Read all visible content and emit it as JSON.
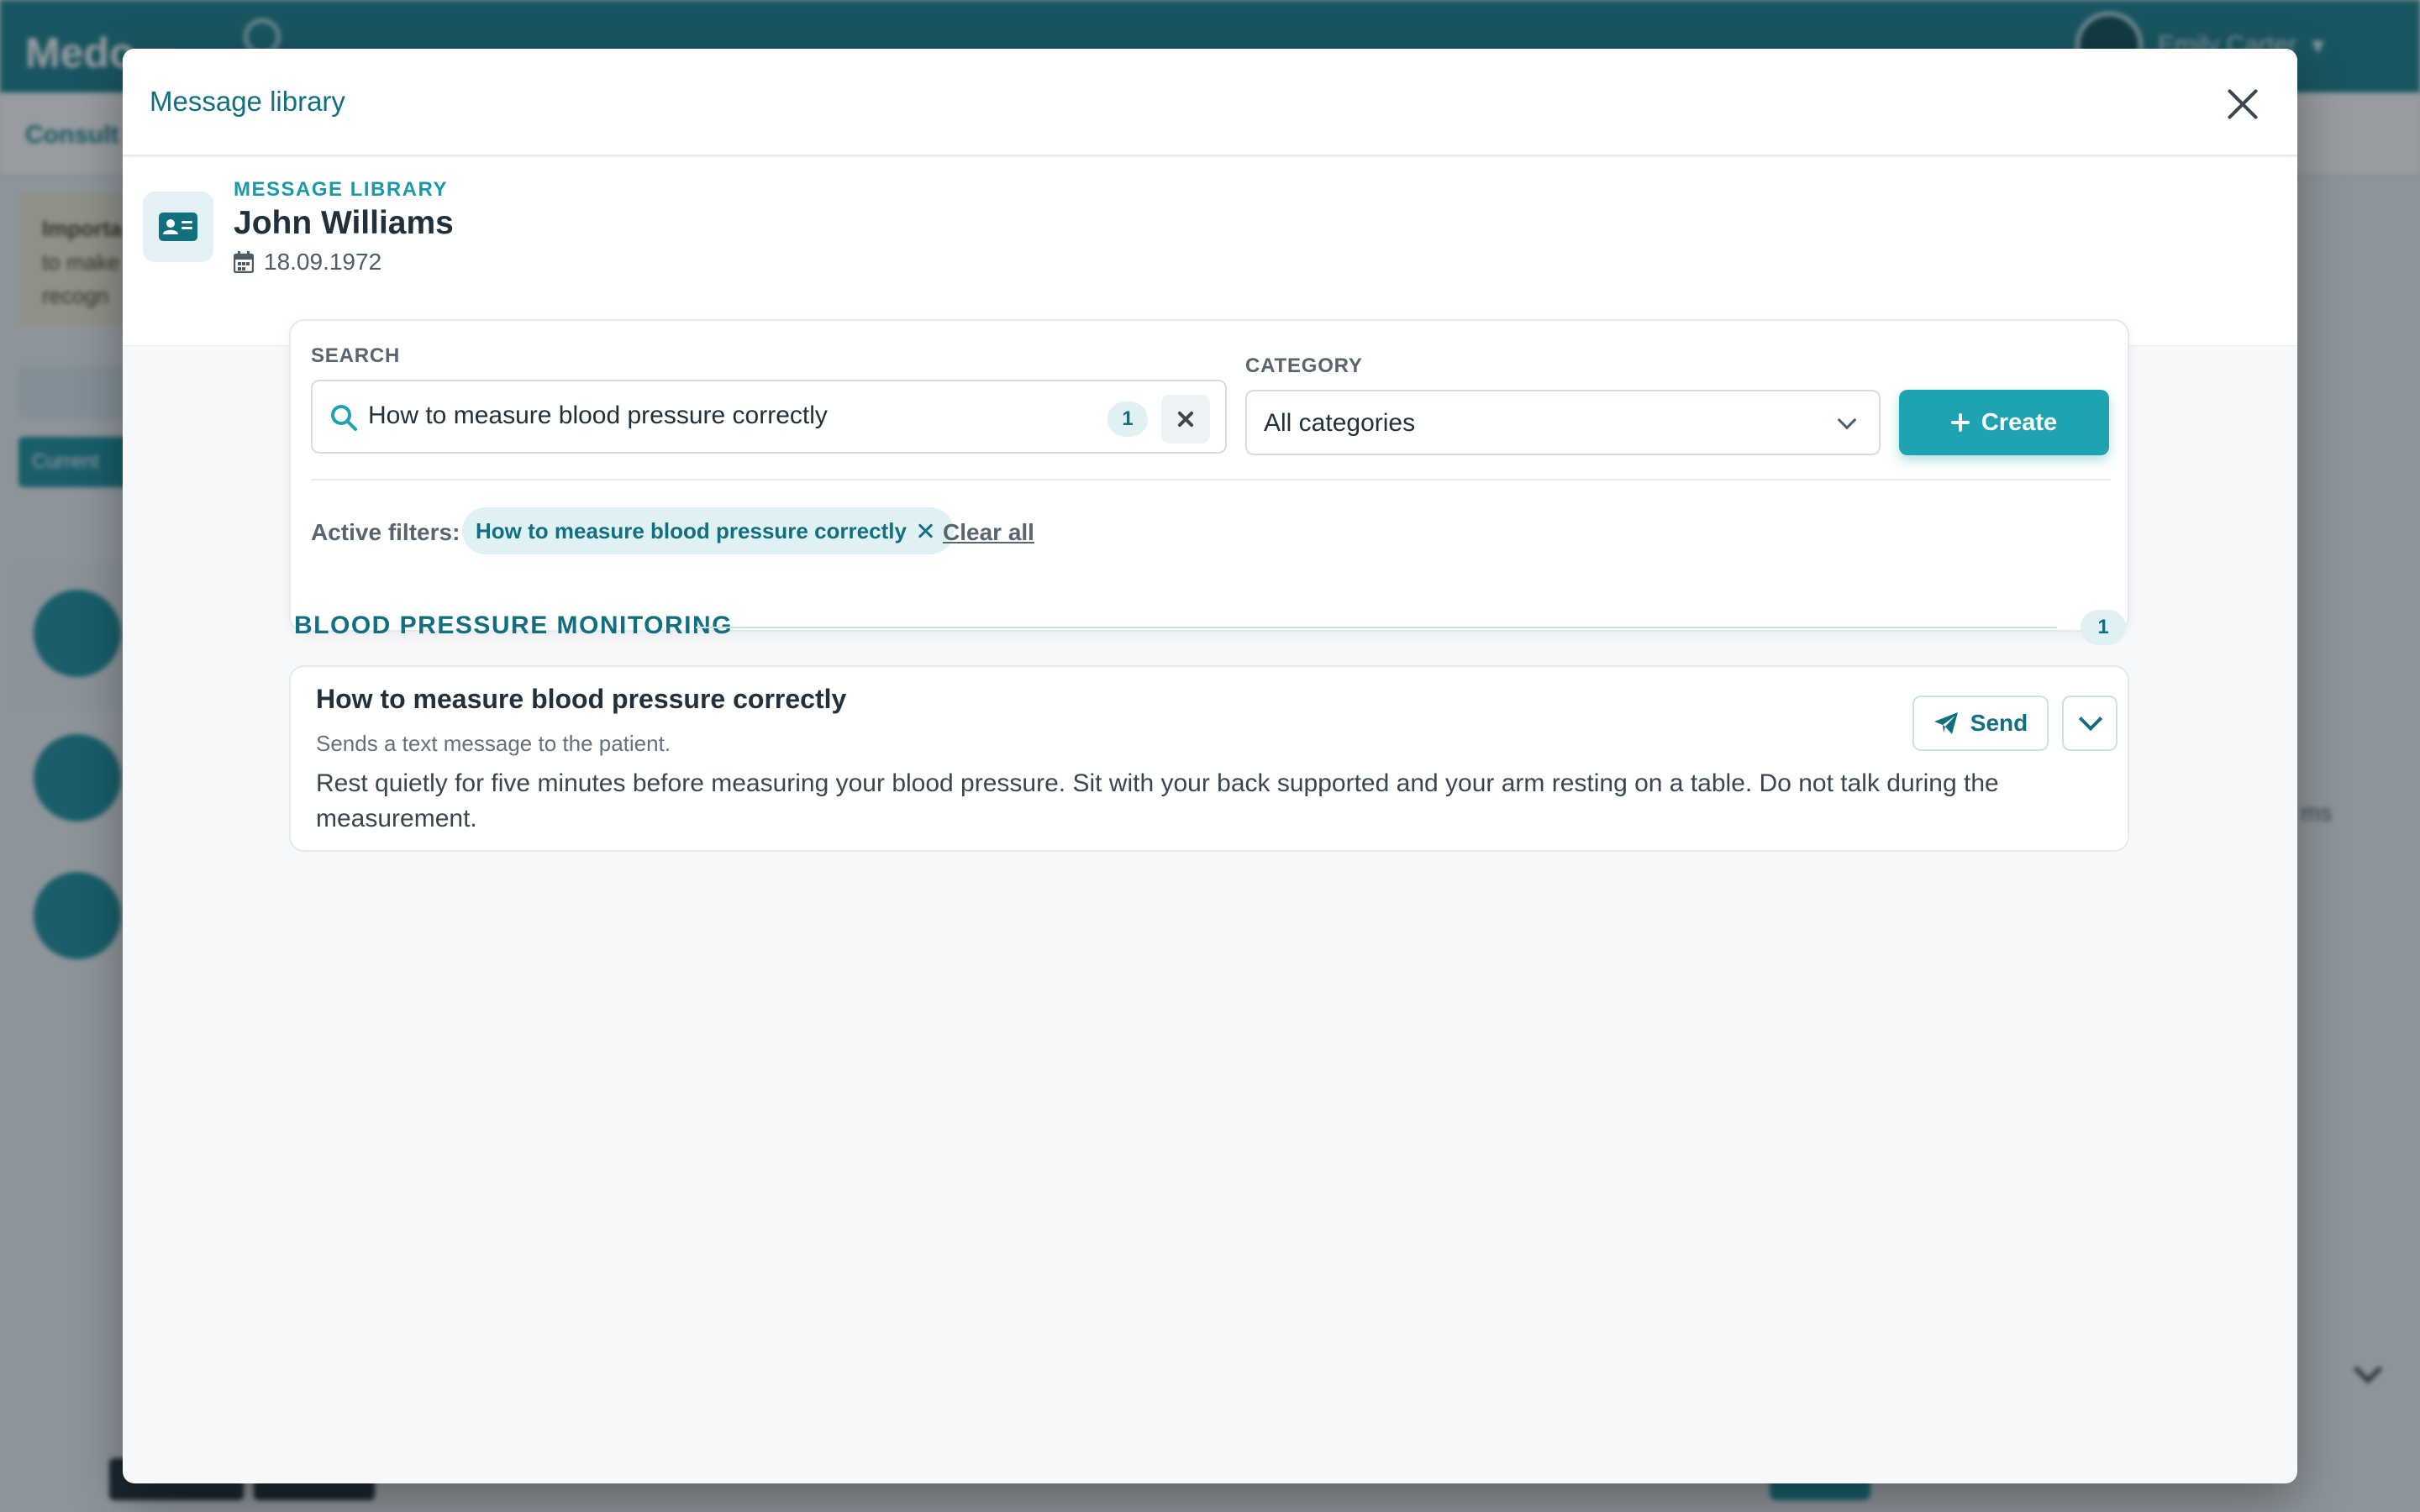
{
  "background": {
    "app_name": "Medo",
    "user_name": "Emily Carter",
    "page_title": "Consult",
    "notice_title": "Importa",
    "notice_body": [
      "to make",
      "recogn"
    ],
    "current_tab_label": "Current",
    "right_fragments": [
      "ms"
    ]
  },
  "modal": {
    "title": "Message library",
    "close_label": "Close"
  },
  "patient": {
    "section_label": "MESSAGE LIBRARY",
    "name": "John Williams",
    "date_of_birth": "18.09.1972",
    "icon": "id-card-icon"
  },
  "search": {
    "label": "SEARCH",
    "value": "How to measure blood pressure correctly",
    "result_count": "1",
    "icon": "search-icon"
  },
  "category": {
    "label": "CATEGORY",
    "selected": "All categories"
  },
  "create_button": {
    "label": "Create"
  },
  "filters": {
    "label": "Active filters:",
    "chips": [
      "How to measure blood pressure correctly"
    ],
    "clear_all_label": "Clear all"
  },
  "groups": [
    {
      "title": "BLOOD PRESSURE MONITORING",
      "count": "1",
      "messages": [
        {
          "title": "How to measure blood pressure correctly",
          "subtitle": "Sends a text message to the patient.",
          "body": "Rest quietly for five minutes before measuring your blood pressure. Sit with your back supported and your arm resting on a table. Do not talk during the measurement.",
          "send_label": "Send"
        }
      ]
    }
  ],
  "colors": {
    "brand_teal": "#1a7f8c",
    "accent": "#1fa3b0",
    "text_dark": "#22303b"
  }
}
